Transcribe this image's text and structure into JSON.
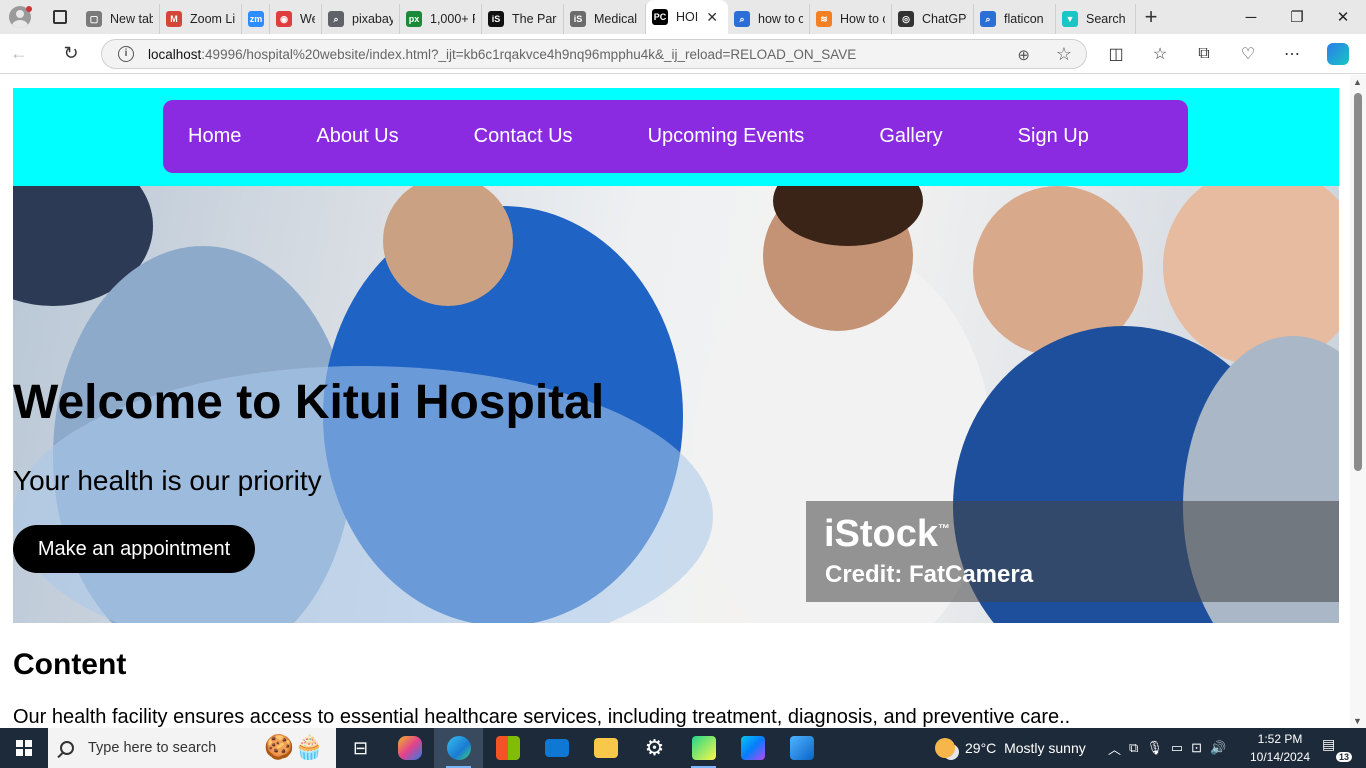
{
  "browser": {
    "tabs": [
      {
        "label": "New tab",
        "fav_color": "#7a7a7a",
        "fav_glyph": "▢",
        "width": 80
      },
      {
        "label": "Zoom Li",
        "fav_color": "#d44638",
        "fav_glyph": "M",
        "width": 82
      },
      {
        "label": "",
        "fav_color": "#2d8cff",
        "fav_glyph": "zm",
        "width": 28
      },
      {
        "label": "Wel",
        "fav_color": "#e03e3e",
        "fav_glyph": "◉",
        "width": 52
      },
      {
        "label": "pixabay",
        "fav_color": "#5f6368",
        "fav_glyph": "⌕",
        "width": 78
      },
      {
        "label": "1,000+ F",
        "fav_color": "#1a8a3a",
        "fav_glyph": "px",
        "width": 82
      },
      {
        "label": "The Para",
        "fav_color": "#111111",
        "fav_glyph": "iS",
        "width": 82
      },
      {
        "label": "Medical",
        "fav_color": "#6b6b6b",
        "fav_glyph": "iS",
        "width": 82
      },
      {
        "label": "HOI",
        "fav_color": "#000000",
        "fav_glyph": "PC",
        "width": 82,
        "active": true
      },
      {
        "label": "how to c",
        "fav_color": "#2b6fd6",
        "fav_glyph": "⌕",
        "width": 82
      },
      {
        "label": "How to c",
        "fav_color": "#f48024",
        "fav_glyph": "≋",
        "width": 82
      },
      {
        "label": "ChatGPT",
        "fav_color": "#333333",
        "fav_glyph": "◎",
        "width": 82
      },
      {
        "label": "flaticon",
        "fav_color": "#2b6fd6",
        "fav_glyph": "⌕",
        "width": 82
      },
      {
        "label": "Search r",
        "fav_color": "#19c5c5",
        "fav_glyph": "▼",
        "width": 80
      }
    ],
    "url_host": "localhost",
    "url_rest": ":49996/hospital%20website/index.html?_ijt=kb6c1rqakvce4h9nq96mpphu4k&_ij_reload=RELOAD_ON_SAVE"
  },
  "site": {
    "nav": [
      "Home",
      "About Us",
      "Contact Us",
      "Upcoming Events",
      "Gallery",
      "Sign Up"
    ],
    "hero_title": "Welcome to Kitui Hospital",
    "hero_subtitle": "Your health is our priority",
    "hero_button": "Make an appointment",
    "watermark_logo": "iStock",
    "watermark_tm": "™",
    "watermark_credit": "Credit: FatCamera",
    "content_heading": "Content",
    "content_text": "Our health facility ensures access to essential healthcare services, including treatment, diagnosis, and preventive care.."
  },
  "taskbar": {
    "search_placeholder": "Type here to search",
    "weather_temp": "29°C",
    "weather_desc": "Mostly sunny",
    "time": "1:52 PM",
    "date": "10/14/2024",
    "notifications": "13"
  }
}
